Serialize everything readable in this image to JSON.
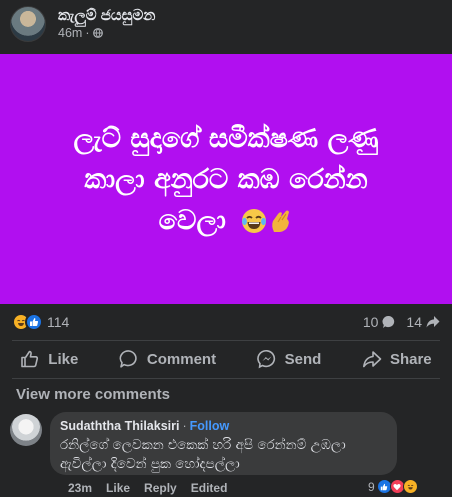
{
  "post": {
    "author": "කැලුම් ජයසුමන",
    "time": "46m",
    "separator": "·",
    "image_text": {
      "line1": "ලැට් සුදාගේ සමීක්ෂණ ලණු",
      "line2": "කාලා අනුරට කඹ රෙන්න",
      "line3": "වෙලා"
    },
    "image_background": "#b10ff0"
  },
  "stats": {
    "reaction_count": "114",
    "comment_count": "10",
    "share_count": "14"
  },
  "actions": {
    "like": "Like",
    "comment": "Comment",
    "send": "Send",
    "share": "Share"
  },
  "comments_section": {
    "view_more": "View more comments",
    "comment": {
      "author": "Sudaththa Thilaksiri",
      "separator": "·",
      "follow": "Follow",
      "text_line1": "රනිල්ගේ ලෙවකන එකෙක් හරි අපි රෙන්නම් උඹලා",
      "text_line2": "ඇවිල්ලා දිවෙන් පුක හෝදපල්ලා",
      "time": "23m",
      "like": "Like",
      "reply": "Reply",
      "edited": "Edited",
      "reaction_count": "9"
    }
  },
  "colors": {
    "background": "#242526",
    "accent": "#4599ff",
    "like_blue": "#1b74e4"
  }
}
